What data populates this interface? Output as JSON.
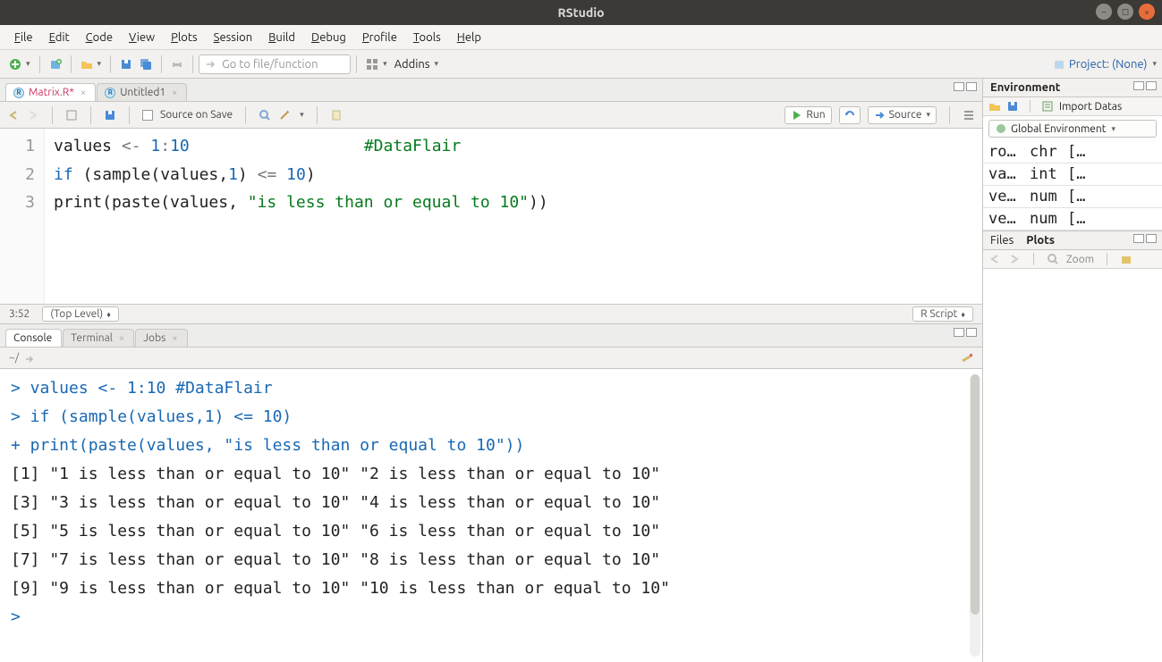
{
  "window": {
    "title": "RStudio"
  },
  "menus": [
    "File",
    "Edit",
    "Code",
    "View",
    "Plots",
    "Session",
    "Build",
    "Debug",
    "Profile",
    "Tools",
    "Help"
  ],
  "toolbar": {
    "goto_placeholder": "Go to file/function",
    "addins": "Addins",
    "project_label": "Project: (None)"
  },
  "editor_tabs": [
    {
      "label": "Matrix.R*",
      "active": true,
      "color": "#c8365f"
    },
    {
      "label": "Untitled1",
      "active": false,
      "color": "#555"
    }
  ],
  "editor_toolbar": {
    "source_on_save": "Source on Save",
    "run": "Run",
    "source": "Source"
  },
  "editor_lines": [
    {
      "n": "1",
      "html": "values <span class='pun'>&lt;-</span> <span class='num'>1</span><span class='pun'>:</span><span class='num'>10</span>                  <span class='com'>#DataFlair</span>"
    },
    {
      "n": "2",
      "html": "<span class='kw'>if</span> (sample(values,<span class='num'>1</span>) <span class='pun'>&lt;=</span> <span class='num'>10</span>)"
    },
    {
      "n": "3",
      "html": "print(paste(values, <span class='str'>\"is less than or equal to 10\"</span>))"
    }
  ],
  "status": {
    "pos": "3:52",
    "scope": "(Top Level)",
    "type": "R Script"
  },
  "console_tabs": [
    "Console",
    "Terminal",
    "Jobs"
  ],
  "console_path": "~/",
  "console_lines": [
    {
      "cls": "pr",
      "text": "> values <- 1:10                 #DataFlair"
    },
    {
      "cls": "pr",
      "text": "> if (sample(values,1) <= 10)"
    },
    {
      "cls": "pr",
      "text": "+ print(paste(values, \"is less than or equal to 10\"))"
    },
    {
      "cls": "out",
      "text": " [1] \"1 is less than or equal to 10\"  \"2 is less than or equal to 10\" "
    },
    {
      "cls": "out",
      "text": " [3] \"3 is less than or equal to 10\"  \"4 is less than or equal to 10\" "
    },
    {
      "cls": "out",
      "text": " [5] \"5 is less than or equal to 10\"  \"6 is less than or equal to 10\" "
    },
    {
      "cls": "out",
      "text": " [7] \"7 is less than or equal to 10\"  \"8 is less than or equal to 10\" "
    },
    {
      "cls": "out",
      "text": " [9] \"9 is less than or equal to 10\"  \"10 is less than or equal to 10\""
    },
    {
      "cls": "pr",
      "text": "> "
    }
  ],
  "env": {
    "tab": "Environment",
    "import": "Import Datas",
    "scope": "Global Environment",
    "rows": [
      {
        "name": "ro…",
        "type": "chr",
        "val": "[…"
      },
      {
        "name": "va…",
        "type": "int",
        "val": "[…"
      },
      {
        "name": "ve…",
        "type": "num",
        "val": "[…"
      },
      {
        "name": "ve…",
        "type": "num",
        "val": "[…"
      }
    ]
  },
  "bottom_right": {
    "tabs": [
      "Files",
      "Plots"
    ],
    "active": "Plots",
    "zoom": "Zoom"
  }
}
